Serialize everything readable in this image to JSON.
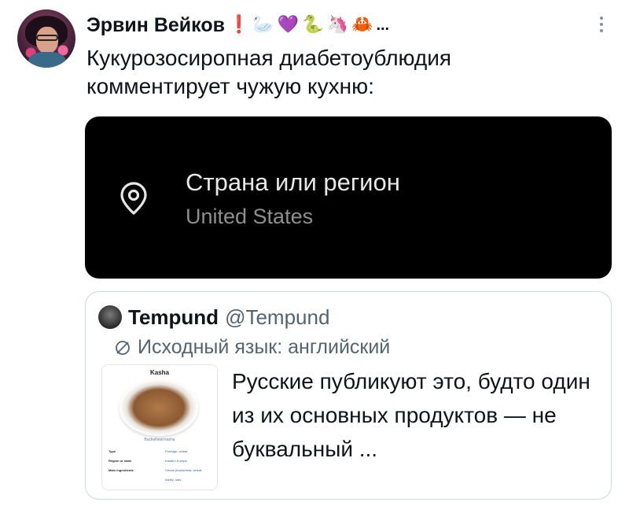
{
  "author": {
    "name": "Эрвин Вейков",
    "emojis": [
      "❗",
      "🦢",
      "💜",
      "🐍",
      "🦄",
      "🦀"
    ],
    "ellipsis": "..."
  },
  "tweet": {
    "text": "Кукурозосиропная диабетоублюдия комментирует чужую кухню:"
  },
  "media": {
    "region_title": "Страна или регион",
    "region_value": "United States"
  },
  "quote": {
    "name": "Tempund",
    "handle": "@Tempund",
    "language_note": "Исходный язык: английский",
    "text": "Русские публикуют это, будто один из их основных продуктов — не буквальный ...",
    "thumbnail": {
      "title": "Kasha",
      "caption": "Buckwheat kasha",
      "rows": [
        {
          "key": "Type",
          "value": "Porridge, cereal"
        },
        {
          "key": "Region or state",
          "value": "Eastern Europe"
        },
        {
          "key": "Main ingredients",
          "value": "Cereal (buckwheat, wheat, barley, oats"
        }
      ]
    }
  },
  "colors": {
    "media_background": "#000000",
    "handle_gray": "#536471",
    "border": "#cfd9de"
  },
  "icons": {
    "location": "map-pin-icon",
    "translate": "globe-icon",
    "more": "more-options-icon"
  }
}
